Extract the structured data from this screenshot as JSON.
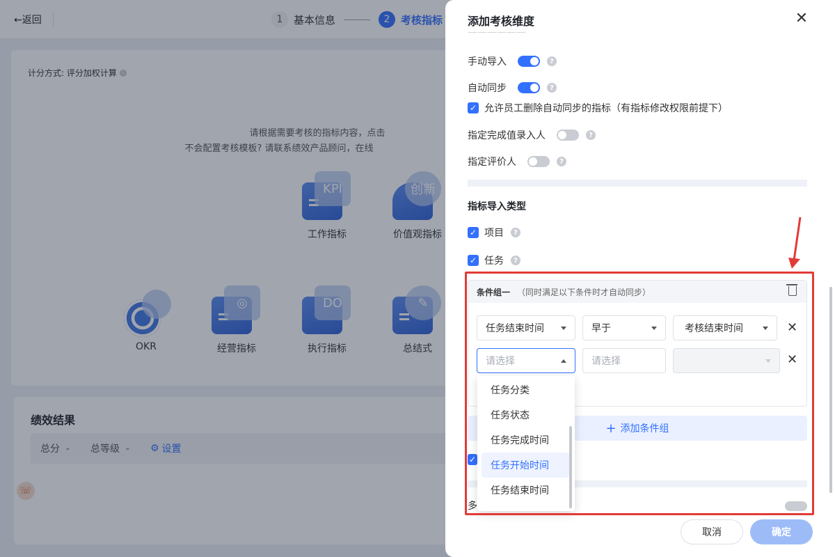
{
  "header": {
    "back_label": "←返回",
    "steps": [
      {
        "num": "1",
        "label": "基本信息"
      },
      {
        "num": "2",
        "label": "考核指标"
      }
    ]
  },
  "scoring": {
    "label": "计分方式: 评分加权计算"
  },
  "hints": {
    "line1": "请根据需要考核的指标内容，点击",
    "line2": "不会配置考核模板? 请联系绩效产品顾问，在线"
  },
  "templates": [
    {
      "label": "工作指标",
      "badge": "KPI"
    },
    {
      "label": "价值观指标",
      "badge": "创新"
    },
    {
      "label": "OKR",
      "badge": ""
    },
    {
      "label": "经营指标",
      "badge": ""
    },
    {
      "label": "执行指标",
      "badge": "DO"
    },
    {
      "label": "总结式",
      "badge": ""
    }
  ],
  "performance": {
    "title": "绩效结果",
    "total_label": "总分",
    "total_value": "-",
    "grade_label": "总等级",
    "grade_value": "-",
    "setting_label": "设置"
  },
  "drawer": {
    "title": "添加考核维度",
    "toggles": [
      {
        "label": "手动导入",
        "on": true
      },
      {
        "label": "自动同步",
        "on": true
      }
    ],
    "allow_delete_label": "允许员工删除自动同步的指标（有指标修改权限前提下）",
    "assign_entry_label": "指定完成值录入人",
    "assign_reviewer_label": "指定评价人",
    "import_type_title": "指标导入类型",
    "import_types": [
      "项目",
      "任务"
    ],
    "condition_group": {
      "title": "条件组一",
      "subtitle": "（同时满足以下条件时才自动同步）",
      "row1": {
        "field": "任务结束时间",
        "op": "早于",
        "value": "考核结束时间"
      },
      "row2": {
        "field_placeholder": "请选择",
        "op_placeholder": "请选择",
        "value": ""
      }
    },
    "dropdown_options": [
      "任务分类",
      "任务状态",
      "任务完成时间",
      "任务开始时间",
      "任务结束时间"
    ],
    "dropdown_hover_index": 3,
    "add_group_label": "添加条件组",
    "cancel_label": "取消",
    "ok_label": "确定",
    "partial_char": "多"
  },
  "colors": {
    "primary": "#3370ff",
    "highlight": "#e23b36"
  }
}
